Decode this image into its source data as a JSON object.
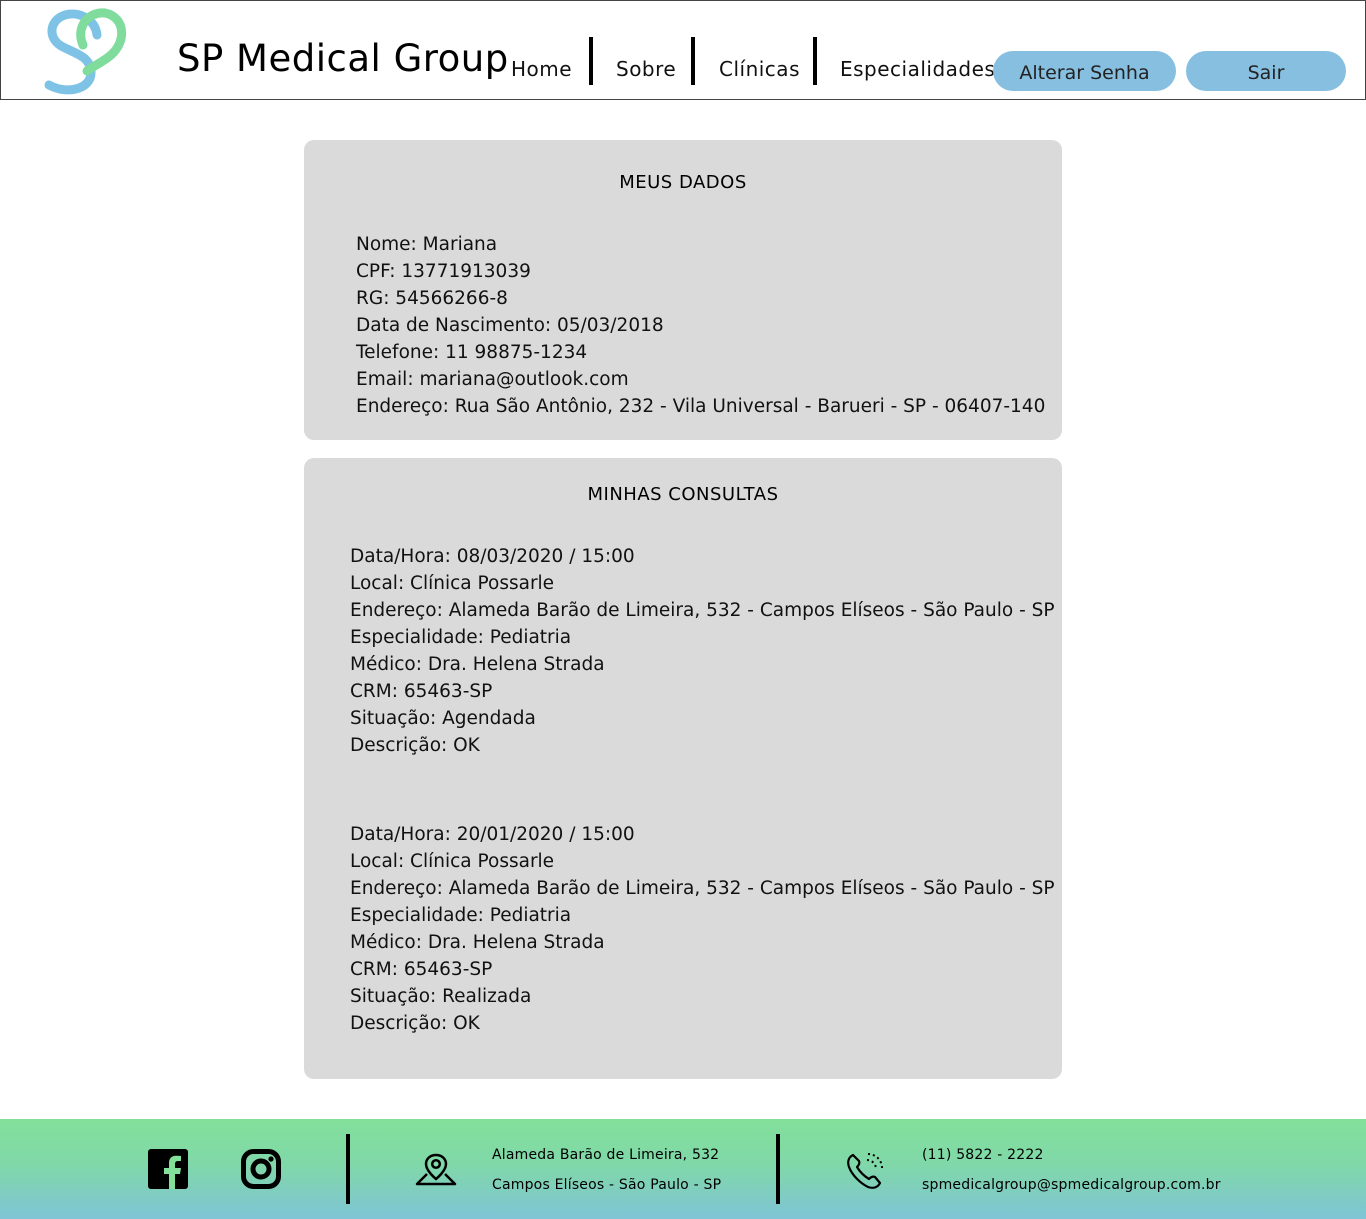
{
  "header": {
    "brand": "SP Medical Group",
    "nav": [
      "Home",
      "Sobre",
      "Clínicas",
      "Especialidades"
    ],
    "buttons": {
      "change_password": "Alterar Senha",
      "logout": "Sair"
    },
    "logo_icon": "sp-heart-logo-icon"
  },
  "my_data": {
    "title": "MEUS DADOS",
    "lines": [
      "Nome: Mariana",
      "CPF: 13771913039",
      "RG: 54566266-8",
      "Data de Nascimento: 05/03/2018",
      "Telefone: 11 98875-1234",
      "Email: mariana@outlook.com",
      "Endereço: Rua São Antônio, 232 - Vila Universal - Barueri - SP - 06407-140"
    ]
  },
  "appointments": {
    "title": "MINHAS CONSULTAS",
    "items": [
      {
        "datetime": "Data/Hora: 08/03/2020 / 15:00",
        "place": "Local: Clínica Possarle",
        "address": "Endereço: Alameda Barão de Limeira, 532 - Campos Elíseos - São Paulo - SP",
        "specialty": "Especialidade: Pediatria",
        "doctor": "Médico: Dra. Helena Strada",
        "crm": "CRM: 65463-SP",
        "status": "Situação: Agendada",
        "description": "Descrição: OK"
      },
      {
        "datetime": "Data/Hora: 20/01/2020 / 15:00",
        "place": "Local: Clínica Possarle",
        "address": "Endereço: Alameda Barão de Limeira, 532 - Campos Elíseos - São Paulo - SP",
        "specialty": "Especialidade: Pediatria",
        "doctor": "Médico: Dra. Helena Strada",
        "crm": "CRM: 65463-SP",
        "status": "Situação: Realizada",
        "description": "Descrição: OK"
      }
    ]
  },
  "footer": {
    "address_line1": "Alameda Barão de Limeira, 532",
    "address_line2": "Campos Elíseos - São Paulo - SP",
    "phone": "(11) 5822 - 2222",
    "email": "spmedicalgroup@spmedicalgroup.com.br",
    "icons": [
      "facebook-icon",
      "instagram-icon",
      "map-pin-icon",
      "phone-icon"
    ]
  },
  "colors": {
    "button_bg": "#86bfe0",
    "card_bg": "#dadada",
    "footer_top": "#82e09a",
    "footer_bottom": "#7fc4d6",
    "logo_blue": "#7ec3e6",
    "logo_green": "#7fdc9c"
  }
}
